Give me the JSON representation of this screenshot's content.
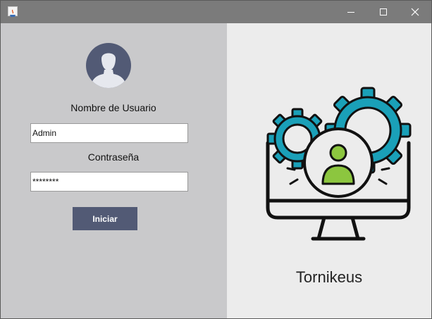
{
  "window": {
    "titlebar_color": "#7b7b7b",
    "controls": [
      "minimize-icon",
      "maximize-icon",
      "close-icon"
    ]
  },
  "login": {
    "avatar_icon": "user-avatar-icon",
    "username_label": "Nombre de Usuario",
    "username_value": "Admin",
    "password_label": "Contraseña",
    "password_value": "********",
    "submit_label": "Iniciar",
    "accent_color": "#525a75"
  },
  "brand": {
    "illustration_icon": "monitor-gears-user-icon",
    "name": "Tornikeus"
  },
  "colors": {
    "left_panel": "#c9c9cb",
    "right_panel": "#ececec",
    "gear_teal": "#1aa0b8",
    "user_green": "#8cc63f"
  }
}
